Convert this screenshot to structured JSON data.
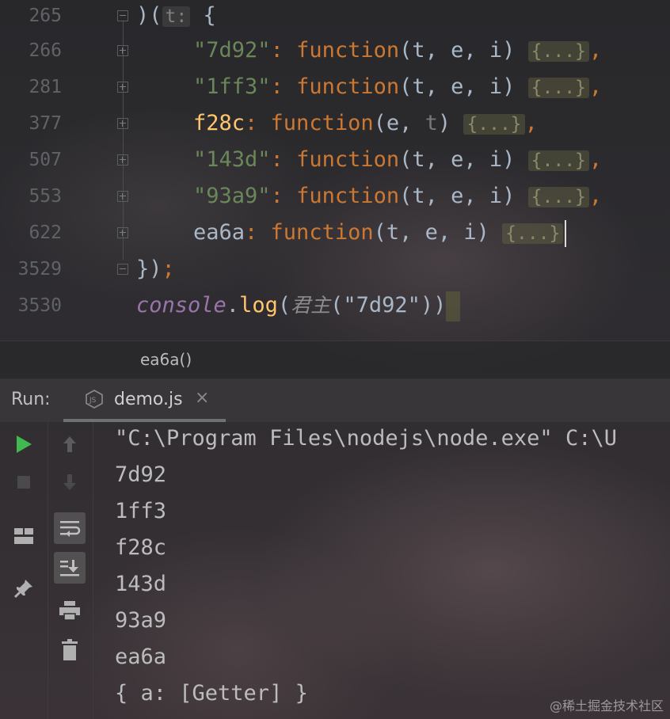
{
  "editor": {
    "line_numbers": [
      "265",
      "266",
      "281",
      "377",
      "507",
      "553",
      "622",
      "3529",
      "3530"
    ],
    "lines": {
      "l265": {
        "a": ")(",
        "hint": "t:",
        "b": " {"
      },
      "l266": {
        "key": "\"7d92\"",
        "colon": ": ",
        "kw": "function",
        "params": "(t, e, i) ",
        "body": "{...}",
        "end": ","
      },
      "l281": {
        "key": "\"1ff3\"",
        "colon": ": ",
        "kw": "function",
        "params": "(t, e, i) ",
        "body": "{...}",
        "end": ","
      },
      "l377": {
        "key": "f28c",
        "colon": ": ",
        "kw": "function",
        "params_a": "(e, ",
        "params_t": "t",
        "params_b": ") ",
        "body": "{...}",
        "end": ","
      },
      "l507": {
        "key": "\"143d\"",
        "colon": ": ",
        "kw": "function",
        "params": "(t, e, i) ",
        "body": "{...}",
        "end": ","
      },
      "l553": {
        "key": "\"93a9\"",
        "colon": ": ",
        "kw": "function",
        "params": "(t, e, i) ",
        "body": "{...}",
        "end": ","
      },
      "l622": {
        "key": "ea6a",
        "colon": ": ",
        "kw": "function",
        "params": "(t, e, i) ",
        "body": "{...}"
      },
      "l3529": {
        "text": "})",
        "semi": ";"
      },
      "l3530": {
        "obj": "console",
        "dot": ".",
        "method": "log",
        "open": "(",
        "fn": "君主",
        "args": "(\"7d92\"))"
      }
    }
  },
  "breadcrumb": "ea6a()",
  "run": {
    "label": "Run:",
    "tab_title": "demo.js",
    "tab_icon": "nodejs-icon",
    "output": [
      "\"C:\\Program Files\\nodejs\\node.exe\" C:\\U",
      "7d92",
      "1ff3",
      "f28c",
      "143d",
      "93a9",
      "ea6a",
      "{ a: [Getter] }"
    ]
  },
  "watermark": "@稀土掘金技术社区",
  "colors": {
    "string": "#6a8759",
    "keyword": "#cc7832",
    "property": "#9876aa",
    "run_green": "#3fb950"
  }
}
